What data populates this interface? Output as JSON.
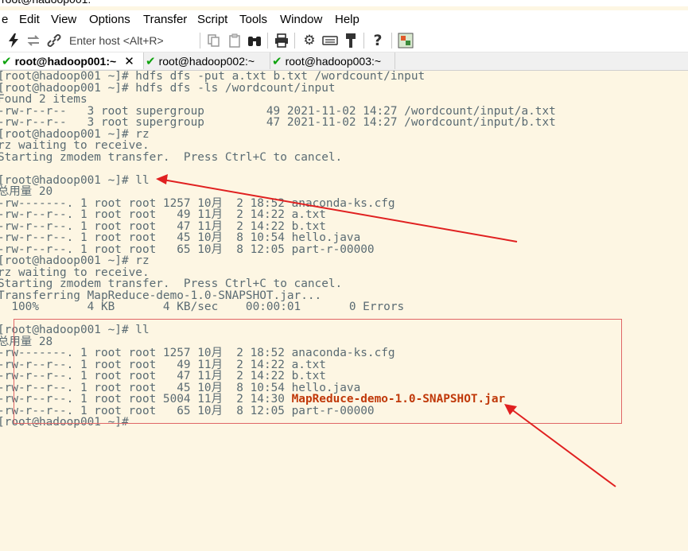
{
  "window": {
    "title": "root@hadoop001:"
  },
  "menu": [
    "e",
    "Edit",
    "View",
    "Options",
    "Transfer",
    "Script",
    "Tools",
    "Window",
    "Help"
  ],
  "toolbar": {
    "host_placeholder": "Enter host <Alt+R>",
    "icons": [
      "lightning-icon",
      "reconnect-icon",
      "link-icon",
      "copy-icon",
      "paste-icon",
      "find-icon",
      "print-icon",
      "settings-icon",
      "keymap-icon",
      "sftp-icon",
      "help-icon",
      "screen-icon"
    ]
  },
  "tabs": [
    {
      "label": "root@hadoop001:~",
      "active": true,
      "closable": true
    },
    {
      "label": "root@hadoop002:~",
      "active": false
    },
    {
      "label": "root@hadoop003:~",
      "active": false
    }
  ],
  "terminal": {
    "lines": [
      "[root@hadoop001 ~]# hdfs dfs -put a.txt b.txt /wordcount/input",
      "[root@hadoop001 ~]# hdfs dfs -ls /wordcount/input",
      "Found 2 items",
      "-rw-r--r--   3 root supergroup         49 2021-11-02 14:27 /wordcount/input/a.txt",
      "-rw-r--r--   3 root supergroup         47 2021-11-02 14:27 /wordcount/input/b.txt",
      "[root@hadoop001 ~]# rz",
      "rz waiting to receive.",
      "Starting zmodem transfer.  Press Ctrl+C to cancel.",
      "",
      "[root@hadoop001 ~]# ll",
      "总用量 20",
      "-rw-------. 1 root root 1257 10月  2 18:52 anaconda-ks.cfg",
      "-rw-r--r--. 1 root root   49 11月  2 14:22 a.txt",
      "-rw-r--r--. 1 root root   47 11月  2 14:22 b.txt",
      "-rw-r--r--. 1 root root   45 10月  8 10:54 hello.java",
      "-rw-r--r--. 1 root root   65 10月  8 12:05 part-r-00000",
      "[root@hadoop001 ~]# rz",
      "rz waiting to receive.",
      "Starting zmodem transfer.  Press Ctrl+C to cancel.",
      "Transferring MapReduce-demo-1.0-SNAPSHOT.jar...",
      "  100%       4 KB       4 KB/sec    00:00:01       0 Errors",
      "",
      "[root@hadoop001 ~]# ll",
      "总用量 28",
      "-rw-------. 1 root root 1257 10月  2 18:52 anaconda-ks.cfg",
      "-rw-r--r--. 1 root root   49 11月  2 14:22 a.txt",
      "-rw-r--r--. 1 root root   47 11月  2 14:22 b.txt",
      "-rw-r--r--. 1 root root   45 10月  8 10:54 hello.java",
      "-rw-r--r--. 1 root root 5004 11月  2 14:30 ",
      "-rw-r--r--. 1 root root   65 10月  8 12:05 part-r-00000",
      "[root@hadoop001 ~]# "
    ],
    "highlight_file": "MapReduce-demo-1.0-SNAPSHOT.jar"
  },
  "colors": {
    "terminal_bg": "#fdf6e3",
    "terminal_text": "#5a6b73",
    "highlight_text": "#c0390a",
    "annotation": "#e02020"
  }
}
